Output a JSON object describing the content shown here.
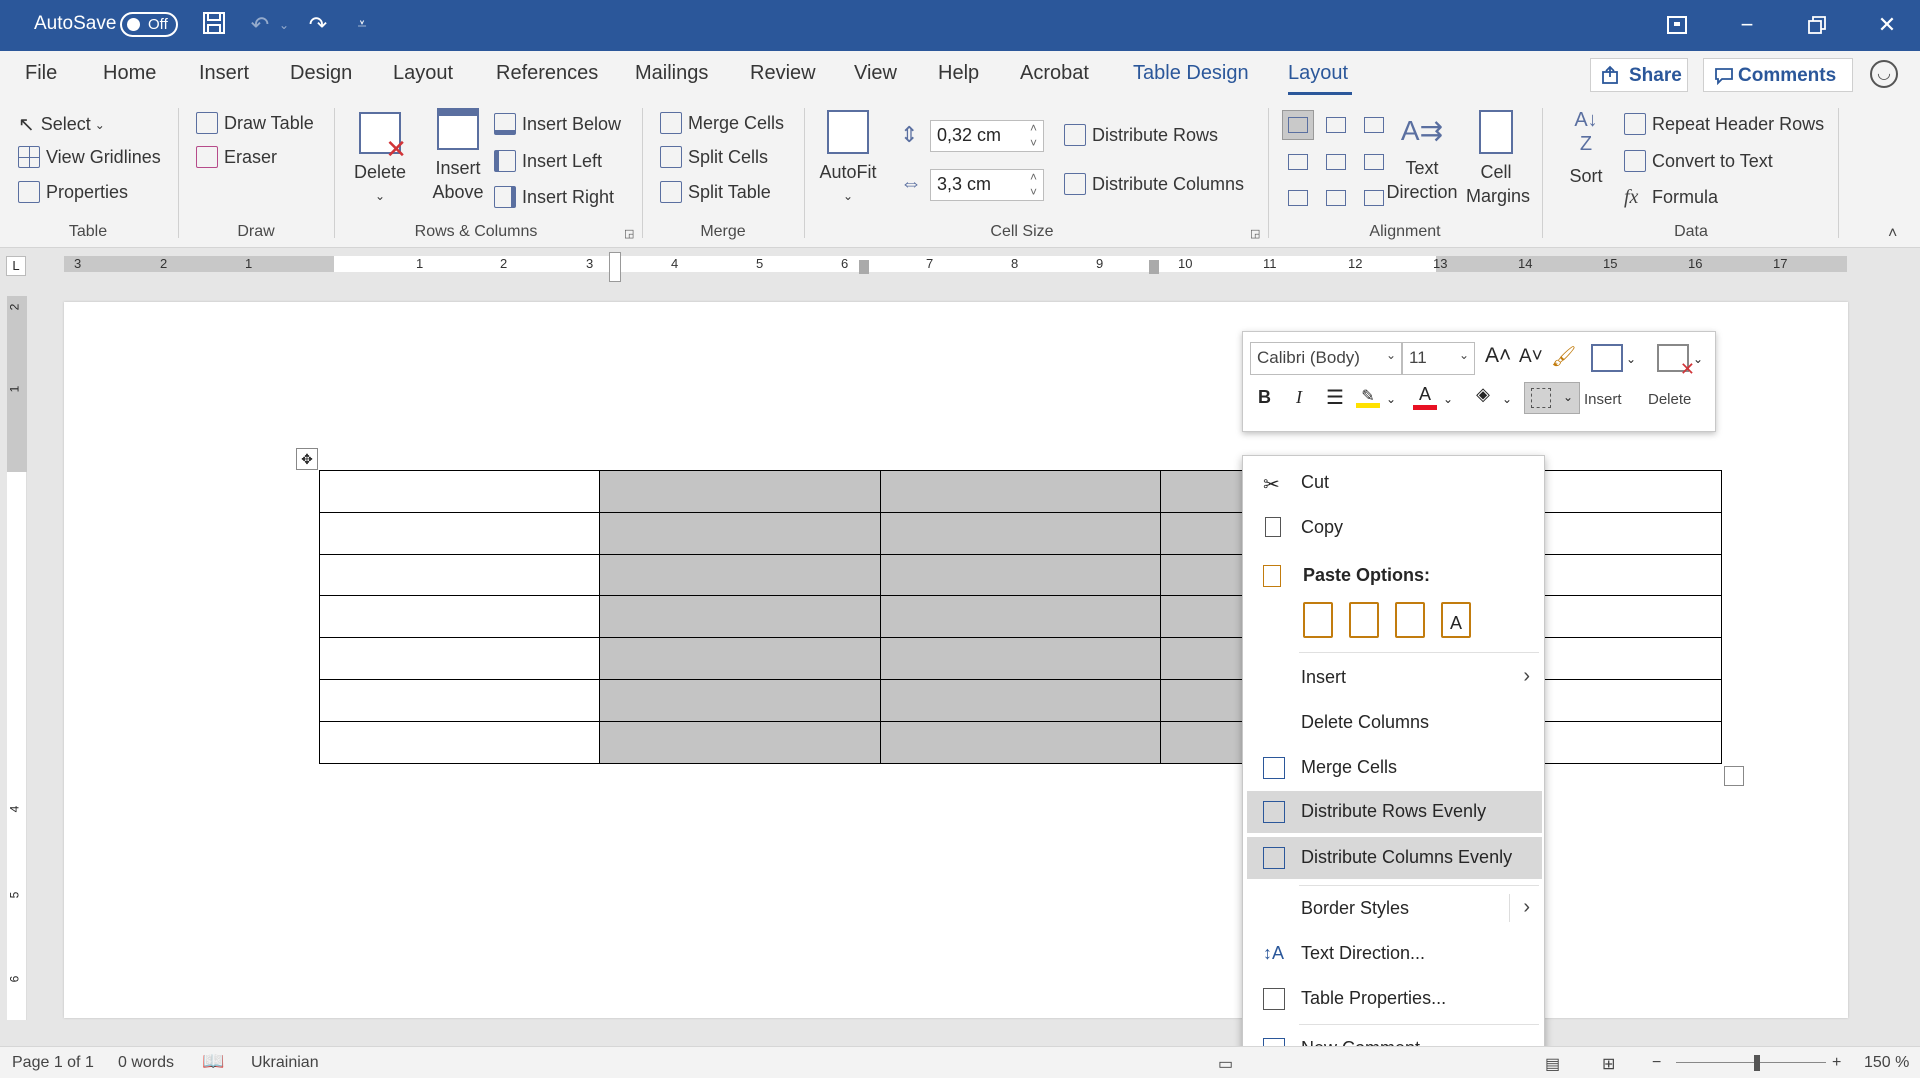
{
  "titlebar": {
    "autosave_label": "AutoSave",
    "autosave_state": "Off"
  },
  "menu": {
    "tabs": [
      "File",
      "Home",
      "Insert",
      "Design",
      "Layout",
      "References",
      "Mailings",
      "Review",
      "View",
      "Help",
      "Acrobat",
      "Table Design",
      "Layout"
    ],
    "active_tab": "Layout",
    "share_label": "Share",
    "comments_label": "Comments"
  },
  "ribbon": {
    "table": {
      "select": "Select",
      "view_gridlines": "View Gridlines",
      "properties": "Properties",
      "label": "Table"
    },
    "draw": {
      "draw_table": "Draw Table",
      "eraser": "Eraser",
      "label": "Draw"
    },
    "rows_columns": {
      "delete": "Delete",
      "insert_above_1": "Insert",
      "insert_above_2": "Above",
      "insert_below": "Insert Below",
      "insert_left": "Insert Left",
      "insert_right": "Insert Right",
      "label": "Rows & Columns"
    },
    "merge": {
      "merge_cells": "Merge Cells",
      "split_cells": "Split Cells",
      "split_table": "Split Table",
      "label": "Merge"
    },
    "cell_size": {
      "autofit": "AutoFit",
      "height_value": "0,32 cm",
      "width_value": "3,3 cm",
      "distribute_rows": "Distribute Rows",
      "distribute_columns": "Distribute Columns",
      "label": "Cell Size"
    },
    "alignment": {
      "text_direction_1": "Text",
      "text_direction_2": "Direction",
      "cell_margins_1": "Cell",
      "cell_margins_2": "Margins",
      "label": "Alignment"
    },
    "data": {
      "sort": "Sort",
      "repeat_header_rows": "Repeat Header Rows",
      "convert_to_text": "Convert to Text",
      "formula": "Formula",
      "label": "Data"
    }
  },
  "ruler": {
    "numbers": [
      "3",
      "2",
      "1",
      "1",
      "2",
      "3",
      "4",
      "5",
      "6",
      "7",
      "8",
      "9",
      "10",
      "11",
      "12",
      "13",
      "14",
      "15",
      "16",
      "17"
    ],
    "vnumbers": [
      "2",
      "1",
      "4",
      "5",
      "6"
    ]
  },
  "mini_toolbar": {
    "font": "Calibri (Body)",
    "size": "11",
    "insert": "Insert",
    "delete": "Delete",
    "bold": "B",
    "italic": "I"
  },
  "context_menu": {
    "cut": "Cut",
    "copy": "Copy",
    "paste_options": "Paste Options:",
    "insert": "Insert",
    "delete_columns": "Delete Columns",
    "merge_cells": "Merge Cells",
    "distribute_rows_evenly": "Distribute Rows Evenly",
    "distribute_columns_evenly": "Distribute Columns Evenly",
    "border_styles": "Border Styles",
    "text_direction": "Text Direction...",
    "table_properties": "Table Properties...",
    "new_comment": "New Comment"
  },
  "status": {
    "page": "Page 1 of 1",
    "words": "0 words",
    "language": "Ukrainian",
    "zoom": "150 %"
  },
  "colors": {
    "title_bar": "#2b579a",
    "selected_cells": "#c4c4c4",
    "menu_highlight": "#d8d8d8"
  }
}
